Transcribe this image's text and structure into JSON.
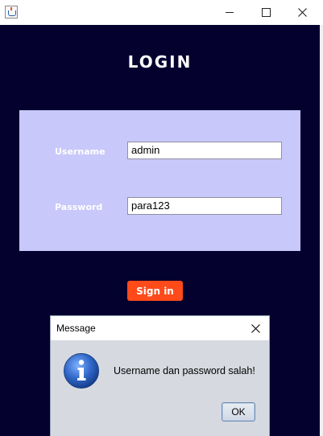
{
  "window": {
    "icon": "java-cup-icon",
    "controls": [
      "minimize-icon",
      "maximize-icon",
      "close-icon"
    ]
  },
  "login": {
    "title": "LOGIN",
    "username_label": "Username",
    "username_value": "admin",
    "password_label": "Password",
    "password_value": "para123",
    "signin_label": "Sign in"
  },
  "dialog": {
    "title": "Message",
    "icon": "info-icon",
    "message": "Username dan password salah!",
    "ok_label": "OK"
  },
  "colors": {
    "background": "#04012e",
    "form_panel": "#c8c8fa",
    "signin_button": "#ff4a1a"
  }
}
